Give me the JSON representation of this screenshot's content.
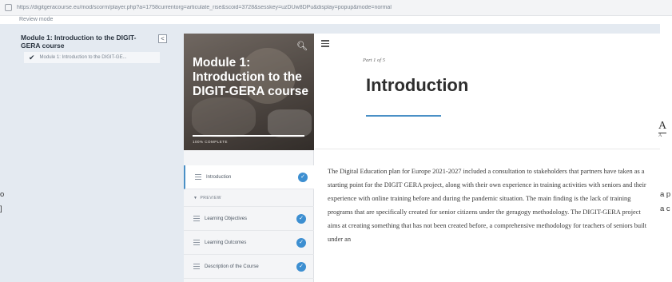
{
  "browser": {
    "url": "https://digitgeracourse.eu/mod/scorm/player.php?a=1758currentorg=articulate_rise&scoid=3728&sesskey=uzDUw8DPu&display=popup&mode=normal"
  },
  "moodle": {
    "review_mode": "Review mode",
    "toc_title": "Module 1: Introduction to the DIGIT-GERA course",
    "toc_close": "<",
    "toc_item": "Module 1: Introduction to the DIGIT-GE...",
    "edge_left_1": "o",
    "edge_left_2": "]",
    "edge_right_1": "a p",
    "edge_right_2": "a c",
    "edge_glyph": "A",
    "edge_glyph_small": "A"
  },
  "player": {
    "course_title": "Module 1: Introduction to the DIGIT-GERA course",
    "complete_label": "100% COMPLETE",
    "progress_fraction": 1.0,
    "nav": [
      {
        "label": "Introduction",
        "done": true,
        "active": true
      },
      {
        "label": "Learning Objectives",
        "done": true,
        "active": false
      },
      {
        "label": "Learning Outcomes",
        "done": true,
        "active": false
      },
      {
        "label": "Description of the Course",
        "done": true,
        "active": false
      }
    ],
    "section_label": "PREVIEW",
    "part": "Part 1 of 5",
    "lesson_title": "Introduction",
    "body": "The Digital Education plan for Europe 2021-2027 included a consultation to stakeholders that partners have taken as a starting point for the DIGIT GERA project, along with their own experience in training activities with seniors and their experience with online training before and during the pandemic situation. The main finding is the lack of training programs that are specifically created for senior citizens under the geragogy methodology. The DIGIT-GERA project aims at creating something that has not been created before, a comprehensive methodology for teachers of seniors built under an",
    "accent_color": "#4a90c6",
    "check_color": "#3d8fd1"
  }
}
